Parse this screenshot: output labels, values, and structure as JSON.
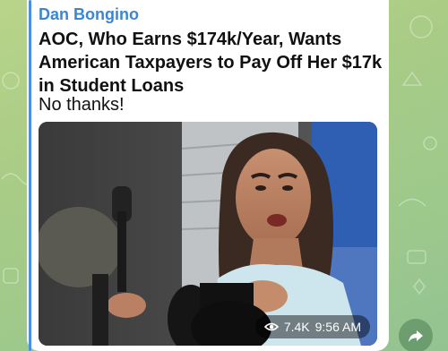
{
  "message": {
    "sender": "Dan Bongino",
    "headline": "AOC, Who Earns $174k/Year, Wants American Taxpayers to Pay Off Her $17k in Student Loans",
    "body": "No thanks!",
    "views": "7.4K",
    "time": "9:56 AM"
  },
  "icons": {
    "views": "eye-icon",
    "forward": "share-arrow-icon"
  },
  "colors": {
    "sender": "#3a86d4",
    "quote_bar": "#4a90e2",
    "wallpaper": "#a9cc86"
  }
}
